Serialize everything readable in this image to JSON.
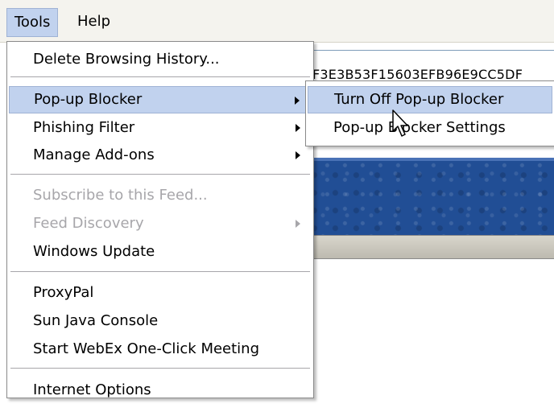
{
  "menubar": {
    "items": [
      "Tools",
      "Help"
    ]
  },
  "address": {
    "text": "F3E3B53F15603EFB96E9CC5DF"
  },
  "tools_menu": {
    "items": [
      {
        "label": "Delete Browsing History...",
        "enabled": true,
        "submenu": false
      },
      {
        "label": "Pop-up Blocker",
        "enabled": true,
        "submenu": true,
        "highlighted": true
      },
      {
        "label": "Phishing Filter",
        "enabled": true,
        "submenu": true
      },
      {
        "label": "Manage Add-ons",
        "enabled": true,
        "submenu": true
      },
      {
        "label": "Subscribe to this Feed...",
        "enabled": false,
        "submenu": false
      },
      {
        "label": "Feed Discovery",
        "enabled": false,
        "submenu": true
      },
      {
        "label": "Windows Update",
        "enabled": true,
        "submenu": false
      },
      {
        "label": "ProxyPal",
        "enabled": true,
        "submenu": false
      },
      {
        "label": "Sun Java Console",
        "enabled": true,
        "submenu": false
      },
      {
        "label": "Start WebEx One-Click Meeting",
        "enabled": true,
        "submenu": false
      },
      {
        "label": "Internet Options",
        "enabled": true,
        "submenu": false
      }
    ]
  },
  "popup_submenu": {
    "items": [
      {
        "label": "Turn Off Pop-up Blocker",
        "highlighted": true
      },
      {
        "label": "Pop-up Blocker Settings"
      }
    ]
  },
  "colors": {
    "highlight": "#c1d2ee",
    "disabled_text": "#a7a6aa",
    "banner_blue": "#214e95"
  }
}
